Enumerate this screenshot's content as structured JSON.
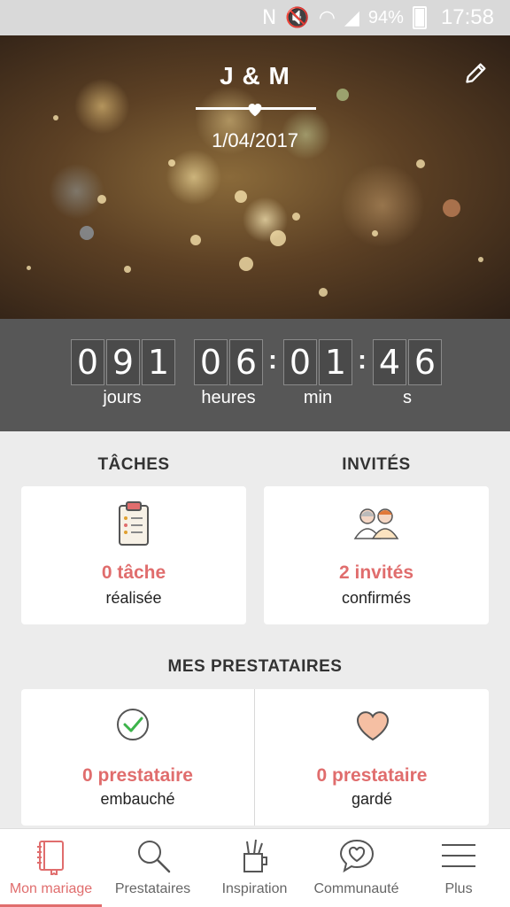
{
  "status_bar": {
    "icons": [
      "nfc-icon",
      "mute-icon",
      "wifi-icon",
      "signal-icon"
    ],
    "battery": "94%",
    "time": "17:58"
  },
  "hero": {
    "couple": "J & M",
    "date": "1/04/2017",
    "edit_icon": "pencil-icon",
    "divider_icon": "heart-icon"
  },
  "countdown": {
    "days": [
      "0",
      "9",
      "1"
    ],
    "hours": [
      "0",
      "6"
    ],
    "minutes": [
      "0",
      "1"
    ],
    "seconds": [
      "4",
      "6"
    ],
    "labels": {
      "days": "jours",
      "hours": "heures",
      "minutes": "min",
      "seconds": "s"
    }
  },
  "tasks": {
    "heading": "TÂCHES",
    "value": "0 tâche",
    "sub": "réalisée",
    "icon": "clipboard-icon"
  },
  "guests": {
    "heading": "INVITÉS",
    "value": "2 invités",
    "sub": "confirmés",
    "icon": "couple-icon"
  },
  "vendors": {
    "heading": "MES PRESTATAIRES",
    "hired": {
      "value": "0 prestataire",
      "sub": "embauché",
      "icon": "check-circle-icon"
    },
    "saved": {
      "value": "0 prestataire",
      "sub": "gardé",
      "icon": "heart-icon"
    }
  },
  "nav": {
    "items": [
      {
        "label": "Mon mariage",
        "icon": "notebook-icon",
        "active": true
      },
      {
        "label": "Prestataires",
        "icon": "search-icon",
        "active": false
      },
      {
        "label": "Inspiration",
        "icon": "pencil-cup-icon",
        "active": false
      },
      {
        "label": "Communauté",
        "icon": "chat-heart-icon",
        "active": false
      },
      {
        "label": "Plus",
        "icon": "menu-icon",
        "active": false
      }
    ]
  },
  "colors": {
    "accent": "#e06d6d",
    "countdown_bg": "#575757",
    "page_bg": "#ececec"
  }
}
